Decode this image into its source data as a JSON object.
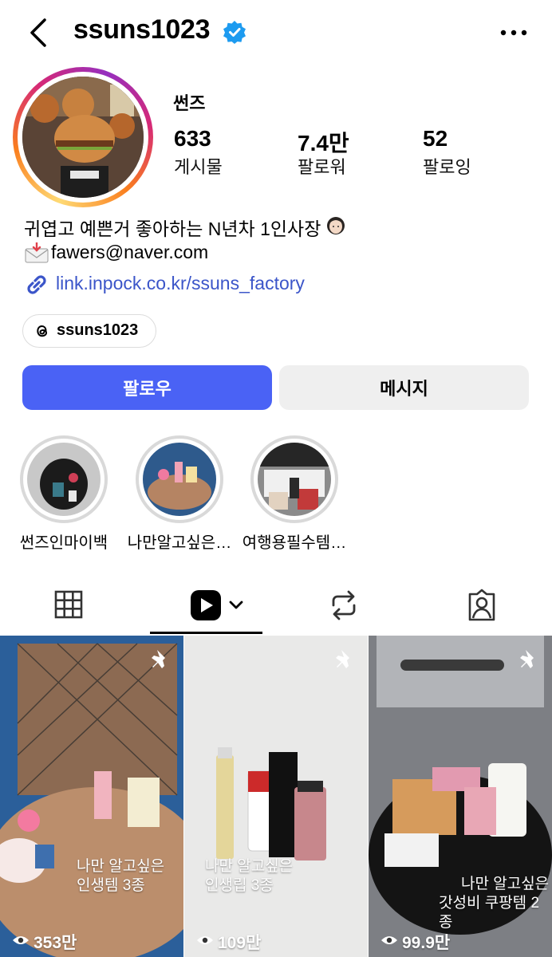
{
  "header": {
    "username": "ssuns1023",
    "back_icon": "chevron-left-icon",
    "verified_icon": "verified-badge-icon",
    "verified_color": "#1d9bf0",
    "more_icon": "more-horizontal-icon"
  },
  "profile": {
    "display_name": "썬즈",
    "stats": [
      {
        "value": "633",
        "label": "게시물"
      },
      {
        "value": "7.4만",
        "label": "팔로워"
      },
      {
        "value": "52",
        "label": "팔로잉"
      }
    ],
    "bio_line1": "귀엽고 예쁜거 좋아하는 N년차 1인사장",
    "bio_email": "fawers@naver.com",
    "link": "link.inpock.co.kr/ssuns_factory",
    "link_color": "#3b55c9",
    "threads_handle": "ssuns1023"
  },
  "actions": {
    "follow_label": "팔로우",
    "message_label": "메시지",
    "follow_color": "#4a62f5"
  },
  "highlights": [
    {
      "label": "썬즈인마이백"
    },
    {
      "label": "나만알고싶은…"
    },
    {
      "label": "여행용필수템…"
    }
  ],
  "tabs": [
    {
      "icon": "grid-icon"
    },
    {
      "icon": "reels-icon",
      "active": true
    },
    {
      "icon": "repost-icon"
    },
    {
      "icon": "tagged-icon"
    }
  ],
  "posts": [
    {
      "caption_line1": "나만 알고싶은",
      "caption_line2": "인생템 3종",
      "views": "353만",
      "pinned": true
    },
    {
      "caption_line1": "나만 알고싶은",
      "caption_line2": "인생립 3종",
      "views": "109만",
      "pinned": true
    },
    {
      "caption_line1": "나만 알고싶은",
      "caption_line2": "갓성비 쿠팡템 2종",
      "views": "99.9만",
      "pinned": true
    }
  ]
}
